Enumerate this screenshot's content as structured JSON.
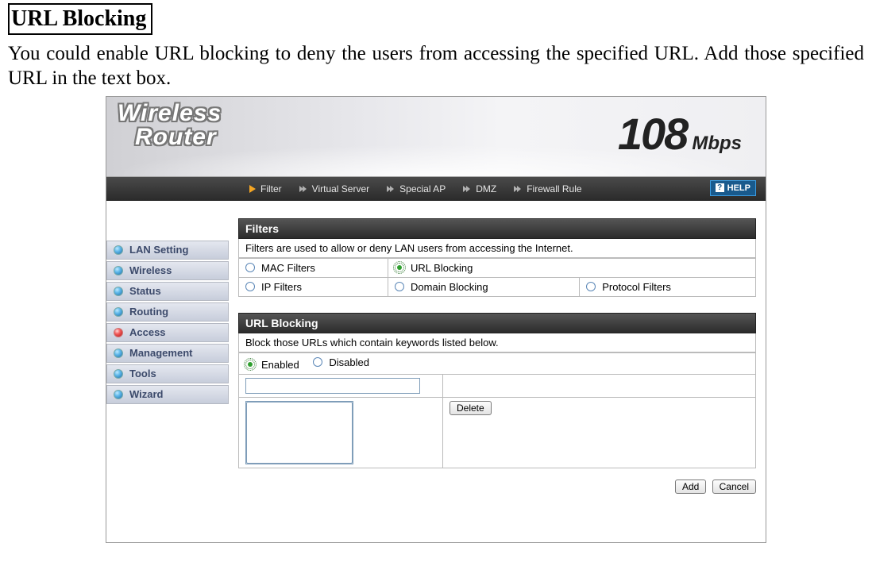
{
  "doc": {
    "title": "URL Blocking",
    "description": "You could enable URL blocking to deny the users from accessing the specified URL.  Add those specified URL in the text box."
  },
  "brand": {
    "line1": "Wireless",
    "line2": "Router"
  },
  "speed": {
    "number": "108",
    "unit": "Mbps"
  },
  "subnav": {
    "items": [
      "Filter",
      "Virtual Server",
      "Special AP",
      "DMZ",
      "Firewall Rule"
    ],
    "help": "HELP"
  },
  "sidebar": {
    "items": [
      {
        "label": "LAN Setting",
        "active": false
      },
      {
        "label": "Wireless",
        "active": false
      },
      {
        "label": "Status",
        "active": false
      },
      {
        "label": "Routing",
        "active": false
      },
      {
        "label": "Access",
        "active": true
      },
      {
        "label": "Management",
        "active": false
      },
      {
        "label": "Tools",
        "active": false
      },
      {
        "label": "Wizard",
        "active": false
      }
    ]
  },
  "filters_panel": {
    "title": "Filters",
    "desc": "Filters are used to allow or deny LAN users from accessing the Internet.",
    "options": {
      "row1": [
        {
          "label": "MAC Filters",
          "selected": false
        },
        {
          "label": "URL Blocking",
          "selected": true
        }
      ],
      "row2": [
        {
          "label": "IP Filters",
          "selected": false
        },
        {
          "label": "Domain Blocking",
          "selected": false
        },
        {
          "label": "Protocol Filters",
          "selected": false
        }
      ]
    }
  },
  "url_panel": {
    "title": "URL Blocking",
    "desc": "Block those URLs which contain keywords listed below.",
    "state": {
      "enabled_label": "Enabled",
      "disabled_label": "Disabled",
      "enabled_selected": true
    },
    "url_value": "",
    "delete_label": "Delete"
  },
  "footer": {
    "add": "Add",
    "cancel": "Cancel"
  }
}
